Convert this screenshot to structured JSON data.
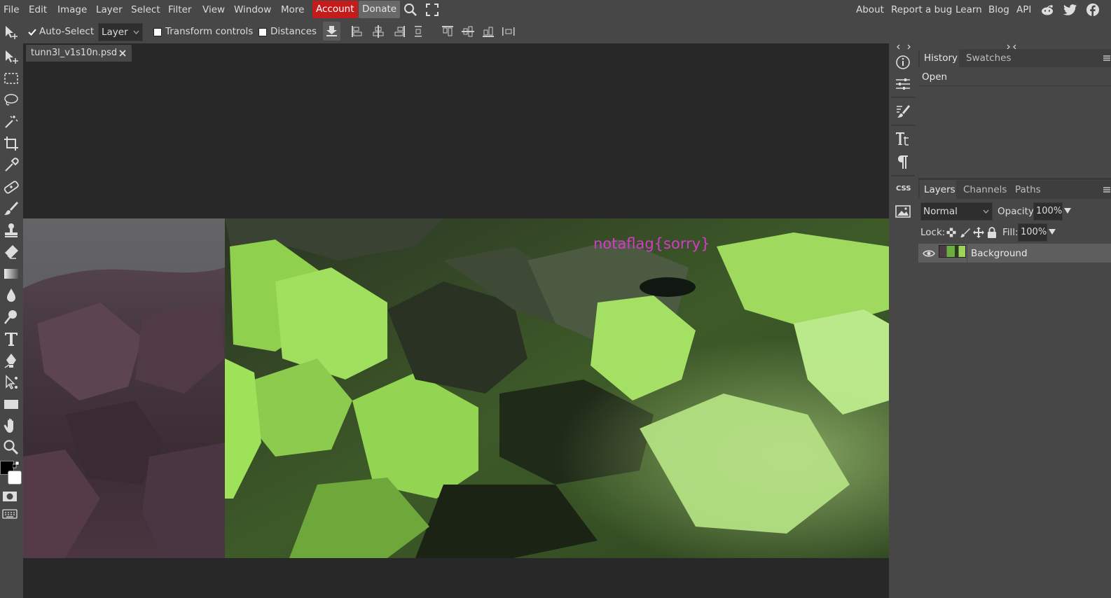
{
  "menu": {
    "items": [
      "File",
      "Edit",
      "Image",
      "Layer",
      "Select",
      "Filter",
      "View",
      "Window",
      "More"
    ],
    "account_label": "Account",
    "donate_label": "Donate",
    "right_links": [
      "About",
      "Report a bug",
      "Learn",
      "Blog",
      "API"
    ]
  },
  "options": {
    "auto_select_label": "Auto-Select",
    "layer_select_value": "Layer",
    "transform_controls_label": "Transform controls",
    "distances_label": "Distances"
  },
  "document": {
    "tab_title": "tunn3l_v1s10n.psd",
    "overlay_text": "notaflag{sorry}"
  },
  "history_panel": {
    "tabs": [
      "History",
      "Swatches"
    ],
    "items": [
      "Open"
    ]
  },
  "layers_panel": {
    "tabs": [
      "Layers",
      "Channels",
      "Paths"
    ],
    "blend_mode": "Normal",
    "opacity_label": "Opacity:",
    "opacity_value": "100%",
    "lock_label": "Lock:",
    "fill_label": "Fill:",
    "fill_value": "100%",
    "layers": [
      {
        "name": "Background",
        "visible": true
      }
    ]
  },
  "sidebar_icons": [
    "info-icon",
    "adjustments-icon",
    "brush-settings-icon",
    "character-icon",
    "paragraph-icon",
    "css-icon",
    "image-icon"
  ],
  "sidebar_css_label": "CSS",
  "colors": {
    "ui_gray": "#474747",
    "workspace": "#282828",
    "account_red": "#c41c1c",
    "flag_text": "#d43cc8"
  }
}
